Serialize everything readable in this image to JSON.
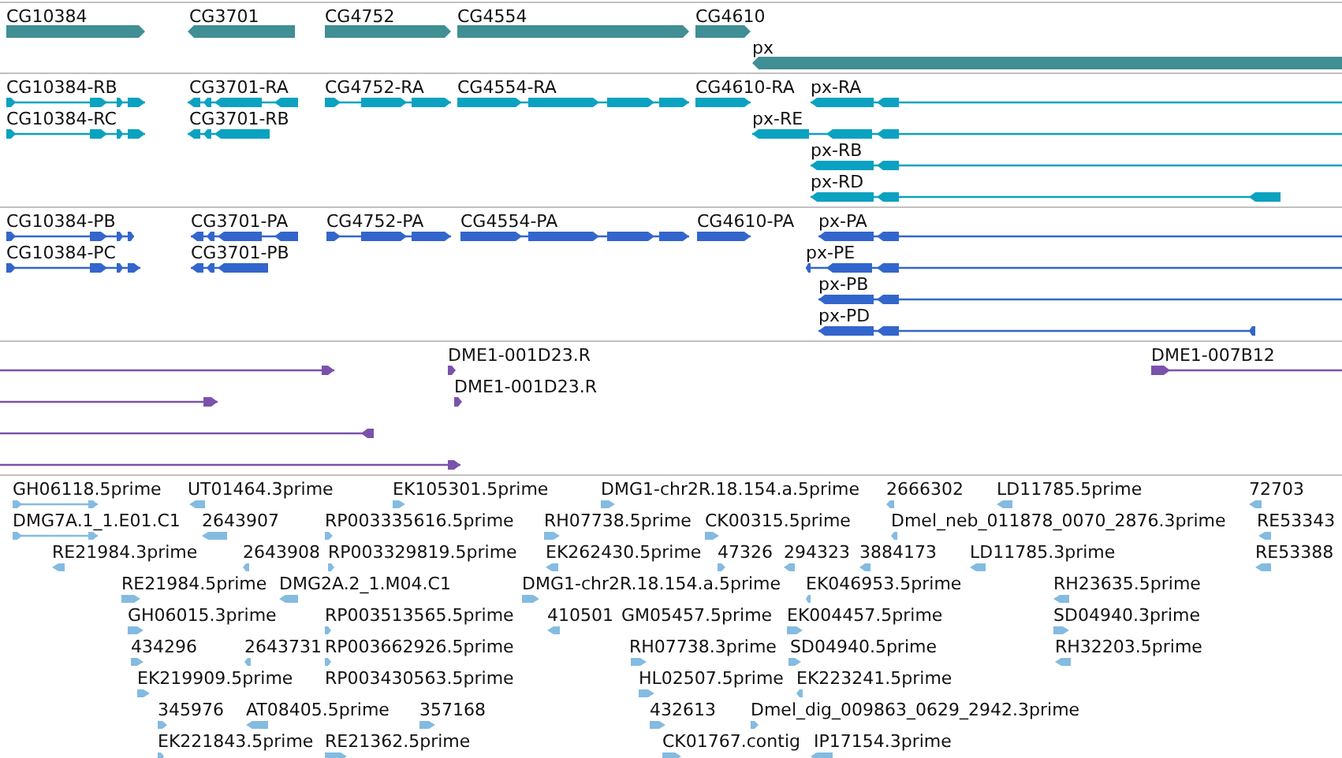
{
  "tracks": [
    {
      "kind": "gene",
      "color": "#408f94",
      "features": [
        {
          "label": "CG10384"
        },
        {
          "label": "CG3701"
        },
        {
          "label": "CG4752"
        },
        {
          "label": "CG4554"
        },
        {
          "label": "CG4610"
        },
        {
          "label": "px"
        }
      ]
    },
    {
      "kind": "transcript",
      "color": "#0aa2c0",
      "features": [
        {
          "label": "CG10384-RB"
        },
        {
          "label": "CG10384-RC"
        },
        {
          "label": "CG3701-RA"
        },
        {
          "label": "CG3701-RB"
        },
        {
          "label": "CG4752-RA"
        },
        {
          "label": "CG4554-RA"
        },
        {
          "label": "CG4610-RA"
        },
        {
          "label": "px-RA"
        },
        {
          "label": "px-RE"
        },
        {
          "label": "px-RB"
        },
        {
          "label": "px-RD"
        }
      ]
    },
    {
      "kind": "transcript",
      "color": "#3366cc",
      "features": [
        {
          "label": "CG10384-PB"
        },
        {
          "label": "CG10384-PC"
        },
        {
          "label": "CG3701-PA"
        },
        {
          "label": "CG3701-PB"
        },
        {
          "label": "CG4752-PA"
        },
        {
          "label": "CG4554-PA"
        },
        {
          "label": "CG4610-PA"
        },
        {
          "label": "px-PA"
        },
        {
          "label": "px-PE"
        },
        {
          "label": "px-PB"
        },
        {
          "label": "px-PD"
        }
      ]
    },
    {
      "kind": "clone",
      "color": "#7b52ab",
      "features": [
        {
          "label": "DME1-001D23.R"
        },
        {
          "label": "DME1-001D23.R"
        },
        {
          "label": "DME1-007B12"
        }
      ]
    },
    {
      "kind": "est",
      "color": "#84bbe0",
      "features": [
        {
          "label": "GH06118.5prime"
        },
        {
          "label": "UT01464.3prime"
        },
        {
          "label": "EK105301.5prime"
        },
        {
          "label": "DMG1-chr2R.18.154.a.5prime"
        },
        {
          "label": "2666302"
        },
        {
          "label": "LD11785.5prime"
        },
        {
          "label": "72703"
        },
        {
          "label": "DMG7A.1_1.E01.C1"
        },
        {
          "label": "2643907"
        },
        {
          "label": "RP003335616.5prime"
        },
        {
          "label": "RH07738.5prime"
        },
        {
          "label": "CK00315.5prime"
        },
        {
          "label": "Dmel_neb_011878_0070_2876.3prime"
        },
        {
          "label": "RE53343"
        },
        {
          "label": "RE21984.3prime"
        },
        {
          "label": "2643908"
        },
        {
          "label": "RP003329819.5prime"
        },
        {
          "label": "EK262430.5prime"
        },
        {
          "label": "47326"
        },
        {
          "label": "294323"
        },
        {
          "label": "3884173"
        },
        {
          "label": "LD11785.3prime"
        },
        {
          "label": "RE53388"
        },
        {
          "label": "RE21984.5prime"
        },
        {
          "label": "DMG2A.2_1.M04.C1"
        },
        {
          "label": "DMG1-chr2R.18.154.a.5prime"
        },
        {
          "label": "EK046953.5prime"
        },
        {
          "label": "RH23635.5prime"
        },
        {
          "label": "GH06015.3prime"
        },
        {
          "label": "RP003513565.5prime"
        },
        {
          "label": "410501"
        },
        {
          "label": "GM05457.5prime"
        },
        {
          "label": "EK004457.5prime"
        },
        {
          "label": "SD04940.3prime"
        },
        {
          "label": "434296"
        },
        {
          "label": "2643731"
        },
        {
          "label": "RP003662926.5prime"
        },
        {
          "label": "RH07738.3prime"
        },
        {
          "label": "SD04940.5prime"
        },
        {
          "label": "RH32203.5prime"
        },
        {
          "label": "EK219909.5prime"
        },
        {
          "label": "RP003430563.5prime"
        },
        {
          "label": "HL02507.5prime"
        },
        {
          "label": "EK223241.5prime"
        },
        {
          "label": "345976"
        },
        {
          "label": "AT08405.5prime"
        },
        {
          "label": "357168"
        },
        {
          "label": "432613"
        },
        {
          "label": "Dmel_dig_009863_0629_2942.3prime"
        },
        {
          "label": "EK221843.5prime"
        },
        {
          "label": "RE21362.5prime"
        },
        {
          "label": "CK01767.contig"
        },
        {
          "label": "IP17154.3prime"
        }
      ]
    }
  ]
}
